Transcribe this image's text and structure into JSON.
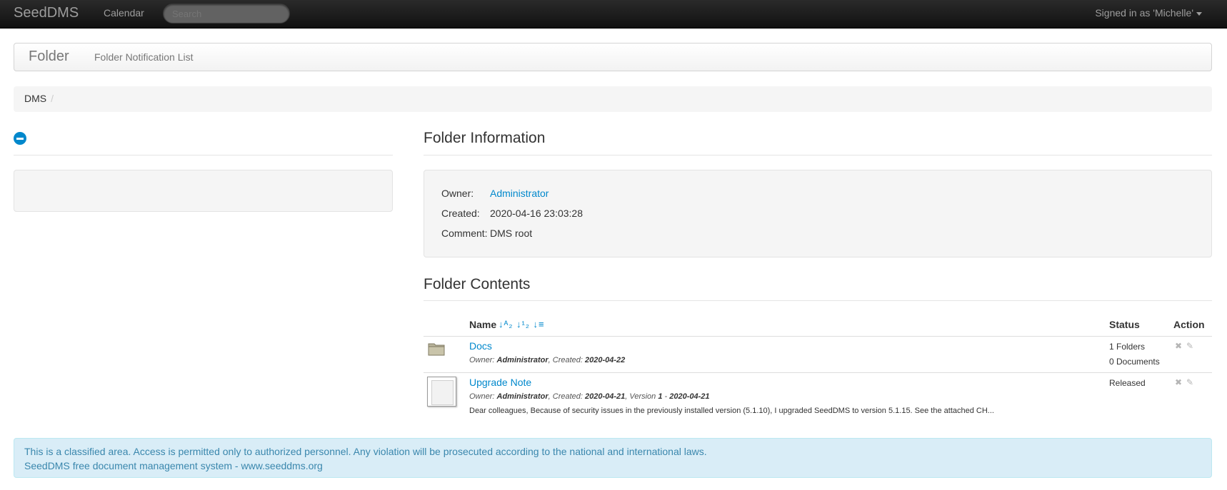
{
  "navbar": {
    "brand": "SeedDMS",
    "calendar": "Calendar",
    "search_placeholder": "Search",
    "signed_in": "Signed in as 'Michelle'"
  },
  "subnav": {
    "title": "Folder",
    "link": "Folder Notification List"
  },
  "breadcrumb": {
    "root": "DMS",
    "separator": "/"
  },
  "folder_info": {
    "heading": "Folder Information",
    "owner_label": "Owner:",
    "owner_value": "Administrator",
    "created_label": "Created:",
    "created_value": "2020-04-16 23:03:28",
    "comment_label": "Comment:",
    "comment_value": "DMS root"
  },
  "folder_contents": {
    "heading": "Folder Contents",
    "columns": {
      "name": "Name",
      "status": "Status",
      "action": "Action"
    },
    "sort_icons": "↓ᴬ₂ ↓¹₂ ↓≡",
    "items": [
      {
        "name": "Docs",
        "owner_prefix": "Owner: ",
        "owner": "Administrator",
        "created_prefix": ", Created: ",
        "created": "2020-04-22",
        "status_line1": "1 Folders",
        "status_line2": "0 Documents",
        "icon": "folder-icon"
      },
      {
        "name": "Upgrade Note",
        "owner_prefix": "Owner: ",
        "owner": "Administrator",
        "created_prefix": ", Created: ",
        "created": "2020-04-21",
        "version_prefix": ", Version ",
        "version": "1",
        "version_sep": " - ",
        "version_date": "2020-04-21",
        "comment": "Dear colleagues, Because of security issues in the previously installed version (5.1.10), I upgraded SeedDMS to version 5.1.15. See the attached CH...",
        "status": "Released",
        "icon": "document-thumbnail"
      }
    ],
    "action_icons": {
      "delete": "✖",
      "edit": "✎"
    }
  },
  "footer": {
    "line1": "This is a classified area. Access is permitted only to authorized personnel. Any violation will be prosecuted according to the national and international laws.",
    "line2": "SeedDMS free document management system - www.seeddms.org"
  },
  "colors": {
    "navbar": "#1b1b1b",
    "link": "#0088cc",
    "alert_bg": "#d9edf7",
    "alert_text": "#3a87ad"
  }
}
